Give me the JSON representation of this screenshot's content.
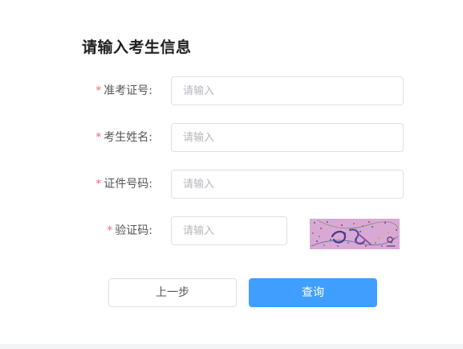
{
  "form": {
    "title": "请输入考生信息",
    "required_mark": "*",
    "fields": [
      {
        "label": "准考证号:",
        "placeholder": "请输入",
        "value": ""
      },
      {
        "label": "考生姓名:",
        "placeholder": "请输入",
        "value": ""
      },
      {
        "label": "证件号码:",
        "placeholder": "请输入",
        "value": ""
      },
      {
        "label": "验证码:",
        "placeholder": "请输入",
        "value": ""
      }
    ]
  },
  "buttons": {
    "prev_label": "上一步",
    "query_label": "查询"
  },
  "colors": {
    "primary": "#409eff",
    "required": "#f56c6c",
    "border": "#dcdfe6",
    "captcha_bg": "#d9a9d6"
  }
}
